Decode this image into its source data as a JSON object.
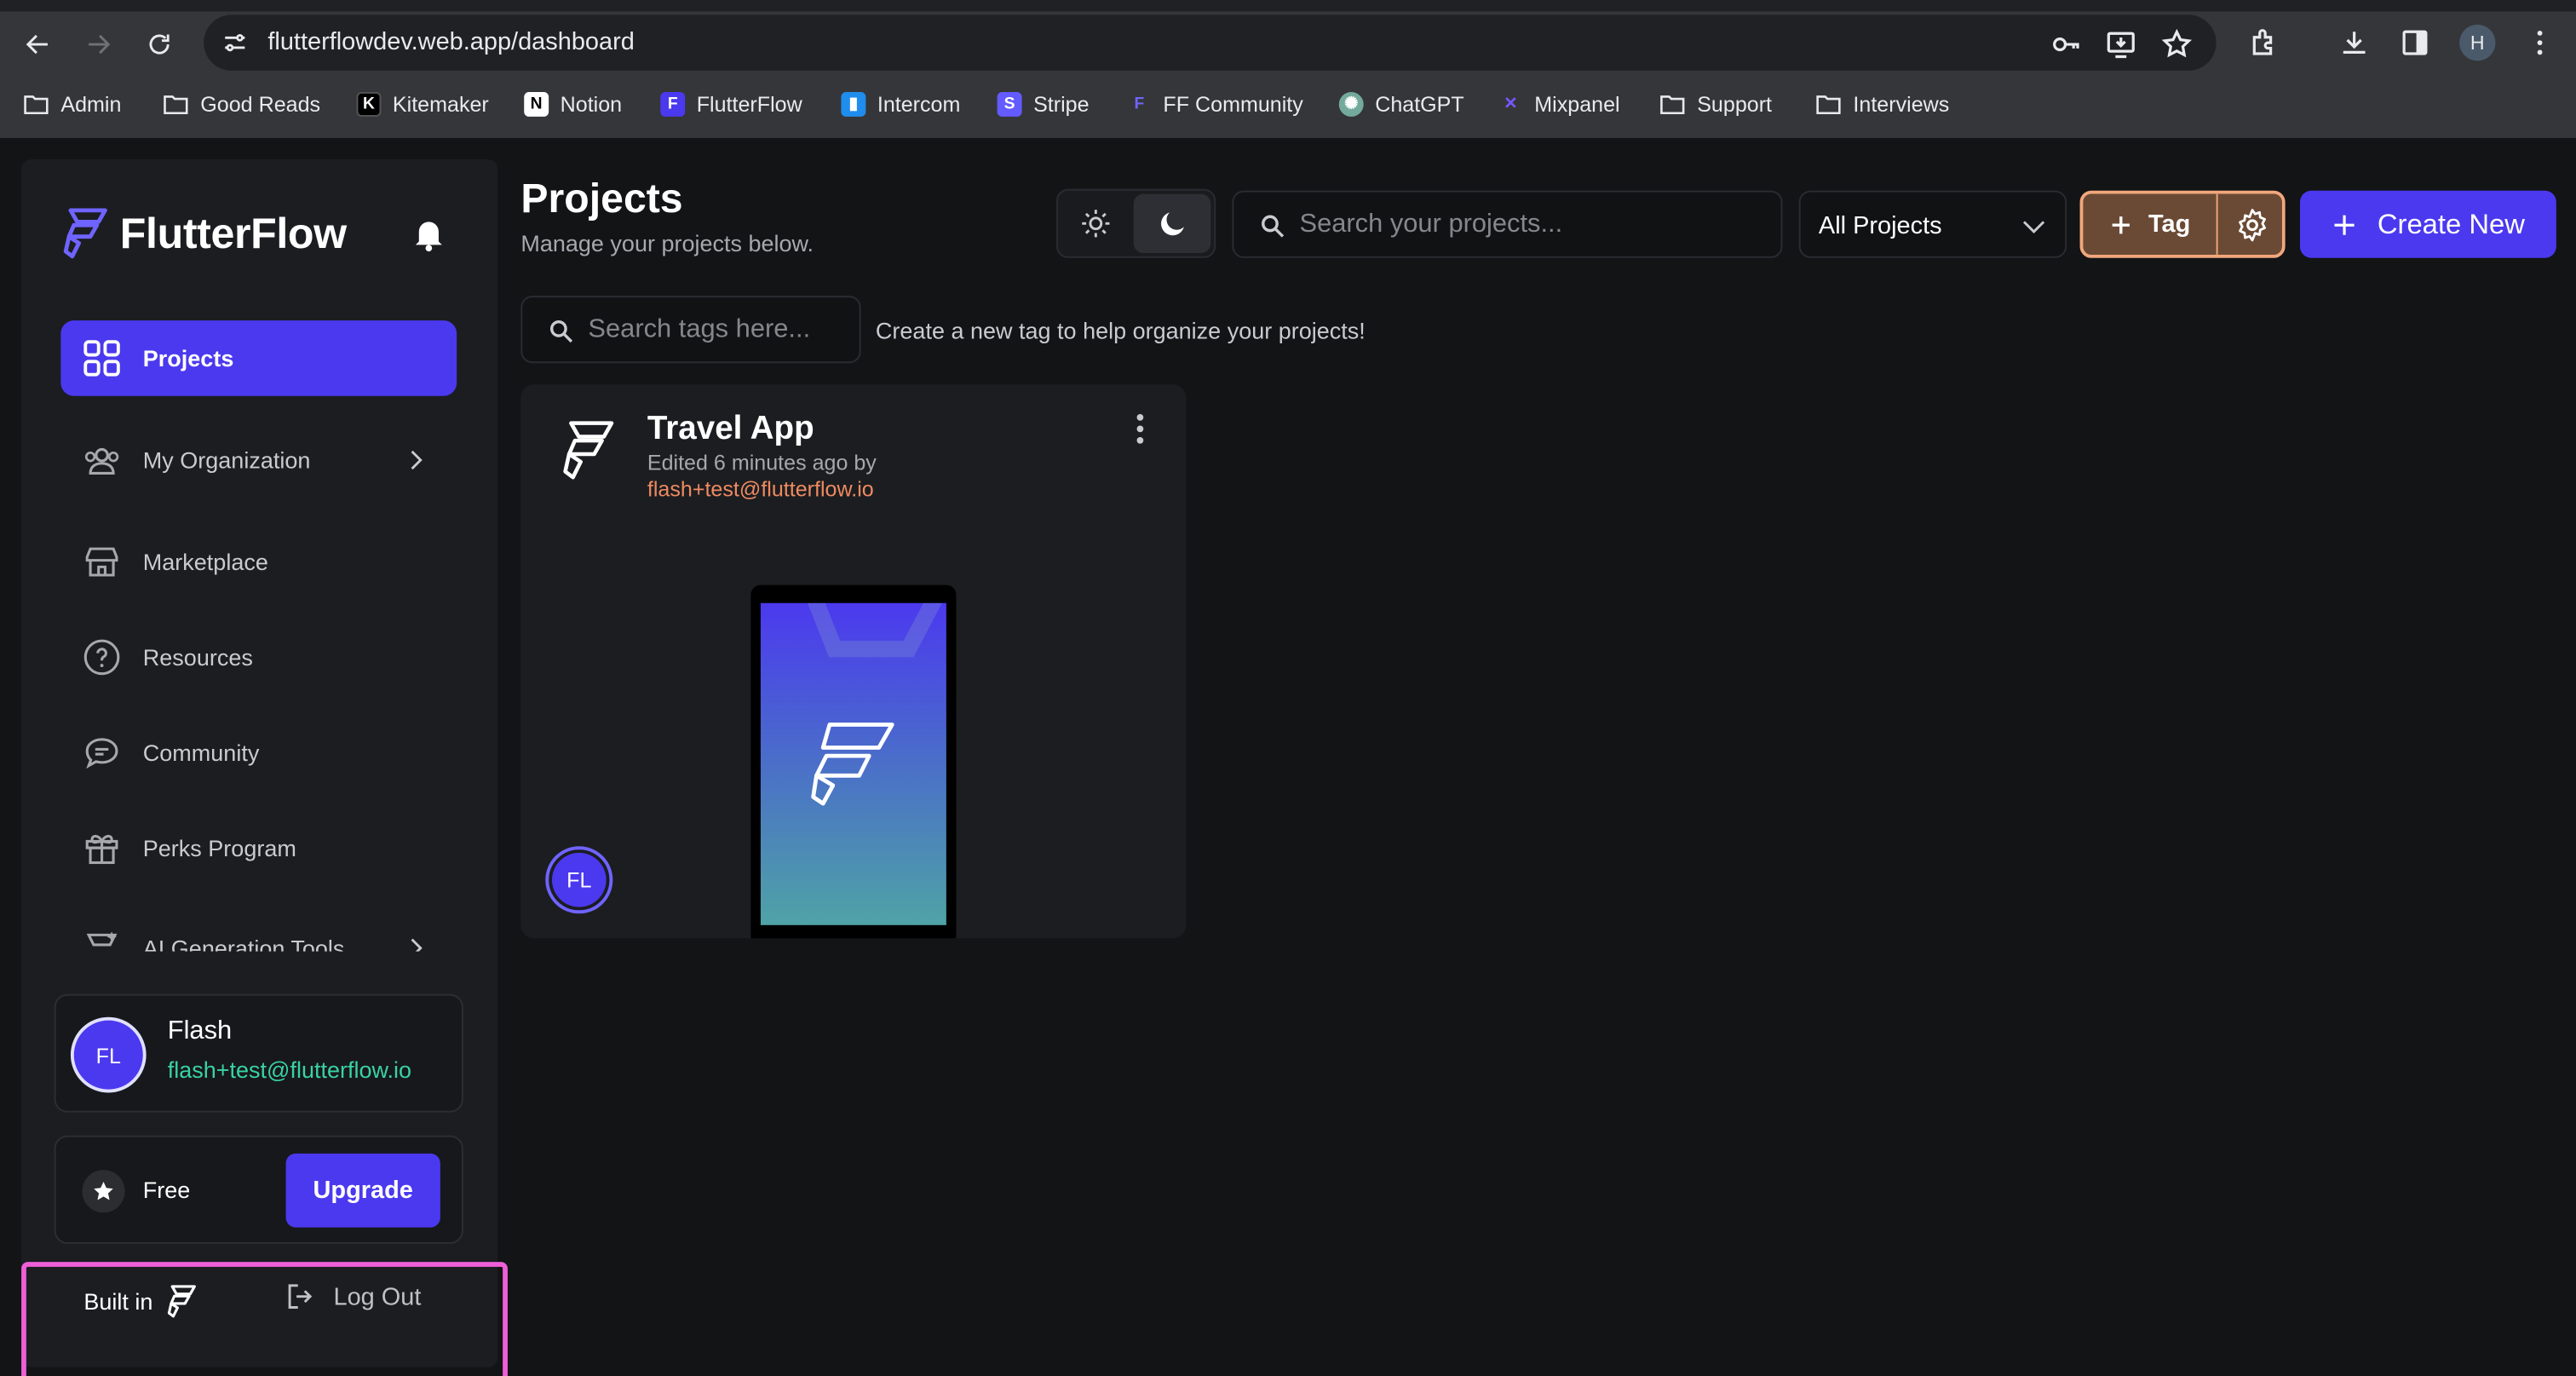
{
  "browser": {
    "url": "flutterflowdev.web.app/dashboard",
    "profile_initial": "H",
    "bookmarks": [
      {
        "label": "Admin",
        "icon": "folder-icon"
      },
      {
        "label": "Good Reads",
        "icon": "folder-icon"
      },
      {
        "label": "Kitemaker",
        "icon": "kitemaker-icon"
      },
      {
        "label": "Notion",
        "icon": "notion-icon"
      },
      {
        "label": "FlutterFlow",
        "icon": "flutterflow-icon"
      },
      {
        "label": "Intercom",
        "icon": "intercom-icon"
      },
      {
        "label": "Stripe",
        "icon": "stripe-icon"
      },
      {
        "label": "FF Community",
        "icon": "flutterflow-icon"
      },
      {
        "label": "ChatGPT",
        "icon": "chatgpt-icon"
      },
      {
        "label": "Mixpanel",
        "icon": "mixpanel-icon"
      },
      {
        "label": "Support",
        "icon": "folder-icon"
      },
      {
        "label": "Interviews",
        "icon": "folder-icon"
      }
    ]
  },
  "sidebar": {
    "brand": "FlutterFlow",
    "nav": [
      {
        "label": "Projects",
        "icon": "grid-icon",
        "active": true
      },
      {
        "label": "My Organization",
        "icon": "people-icon"
      },
      {
        "label": "Marketplace",
        "icon": "store-icon"
      },
      {
        "label": "Resources",
        "icon": "help-circle-icon"
      },
      {
        "label": "Community",
        "icon": "chat-icon"
      },
      {
        "label": "Perks Program",
        "icon": "gift-icon"
      },
      {
        "label": "AI Generation Tools",
        "icon": "ai-icon"
      }
    ],
    "user": {
      "initials": "FL",
      "name": "Flash",
      "email": "flash+test@flutterflow.io"
    },
    "plan": {
      "label": "Free",
      "upgrade_label": "Upgrade"
    },
    "footer": {
      "built_in": "Built in",
      "logout": "Log Out"
    }
  },
  "main": {
    "title": "Projects",
    "subtitle": "Manage your projects below.",
    "search_placeholder": "Search your projects...",
    "filter_value": "All Projects",
    "tag_label": "Tag",
    "create_label": "Create New",
    "tag_search_placeholder": "Search tags here...",
    "tag_hint": "Create a new tag to help organize your projects!",
    "projects": [
      {
        "name": "Travel App",
        "edited": "Edited 6 minutes ago by",
        "editor": "flash+test@flutterflow.io",
        "owner_initials": "FL"
      }
    ]
  },
  "colors": {
    "primary": "#4b39ef",
    "accent_orange": "#ee8b60",
    "accent_teal": "#39d2a4",
    "highlight": "#ee5fd7"
  }
}
